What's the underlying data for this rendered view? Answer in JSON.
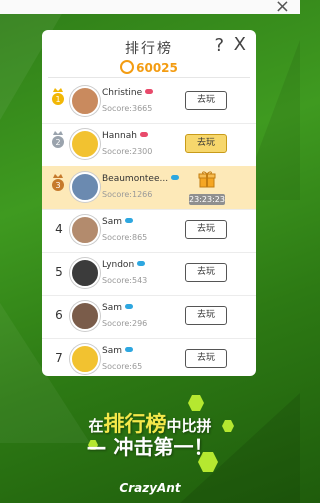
{
  "window": {
    "close_glyph": "×"
  },
  "panel": {
    "title": "排行榜",
    "help_glyph": "?",
    "close_glyph": "X",
    "coins": "60025"
  },
  "rows": [
    {
      "rank": "1",
      "medal": "gold",
      "name": "Christine",
      "gender": "female",
      "score": "Socore:3665",
      "action": "去玩",
      "avatar_color": "#c98a5e"
    },
    {
      "rank": "2",
      "medal": "silver",
      "name": "Hannah",
      "gender": "female",
      "score": "Socore:2300",
      "action": "去玩",
      "action_style": "gold",
      "avatar_color": "#f2c230"
    },
    {
      "rank": "3",
      "medal": "bronze",
      "name": "Beaumontee...",
      "gender": "male",
      "score": "Socore:1266",
      "highlight": true,
      "gift_timer": "23:23:23",
      "avatar_color": "#6b8ab0"
    },
    {
      "rank": "4",
      "name": "Sam",
      "gender": "male",
      "score": "Socore:865",
      "action": "去玩",
      "avatar_color": "#b38b6d"
    },
    {
      "rank": "5",
      "name": "Lyndon",
      "gender": "male",
      "score": "Socore:543",
      "action": "去玩",
      "avatar_color": "#3b3b3b"
    },
    {
      "rank": "6",
      "name": "Sam",
      "gender": "male",
      "score": "Socore:296",
      "action": "去玩",
      "avatar_color": "#7a5c4a"
    },
    {
      "rank": "7",
      "name": "Sam",
      "gender": "male",
      "score": "Socore:65",
      "action": "去玩",
      "avatar_color": "#f2c230"
    }
  ],
  "colors": {
    "female": "#e84a6b",
    "male": "#2ea7e0",
    "coin": "#f39c12",
    "highlight": "#fde9b8"
  },
  "slogan": {
    "pre": "在",
    "big": "排行榜",
    "post": "中比拼",
    "line2": "— 冲击第一！"
  },
  "brand": "CrazyAnt"
}
